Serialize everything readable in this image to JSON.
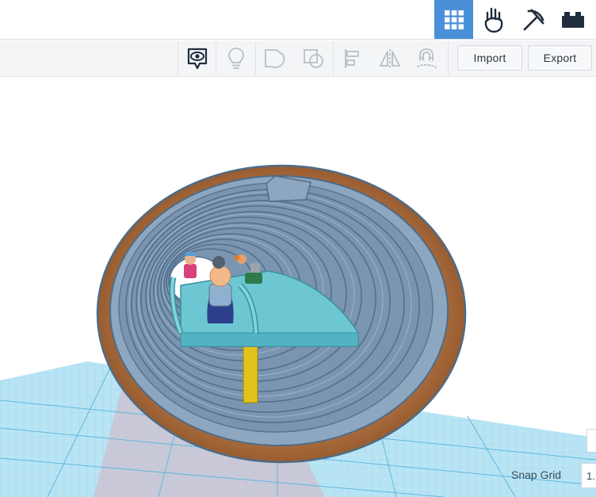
{
  "header": {
    "modes": [
      {
        "name": "3d-design-view",
        "icon": "grid-icon",
        "active": true
      },
      {
        "name": "blocks-view",
        "icon": "hand-icon",
        "active": false
      },
      {
        "name": "bricks-view",
        "icon": "pickaxe-icon",
        "active": false
      },
      {
        "name": "lego-view",
        "icon": "brick-icon",
        "active": false
      }
    ]
  },
  "toolbar": {
    "tools": [
      {
        "name": "show-all-tool",
        "icon": "eye-comment-icon"
      },
      {
        "name": "notes-tool",
        "icon": "lightbulb-icon"
      },
      {
        "name": "group-tool",
        "icon": "group-shapes-icon"
      },
      {
        "name": "ungroup-tool",
        "icon": "ungroup-shapes-icon"
      },
      {
        "name": "align-tool",
        "icon": "align-icon"
      },
      {
        "name": "mirror-tool",
        "icon": "mirror-icon"
      },
      {
        "name": "cruise-tool",
        "icon": "magnet-icon"
      }
    ],
    "import_label": "Import",
    "export_label": "Export"
  },
  "workplane": {
    "snap_grid_label": "Snap Grid",
    "snap_grid_value": "1.",
    "colors": {
      "grid": "#3fb6e3",
      "tunnel_outer": "#a8663a",
      "tunnel_inner": "#7d97b2",
      "platform": "#6cc7d3",
      "pole": "#e3c31b"
    }
  }
}
